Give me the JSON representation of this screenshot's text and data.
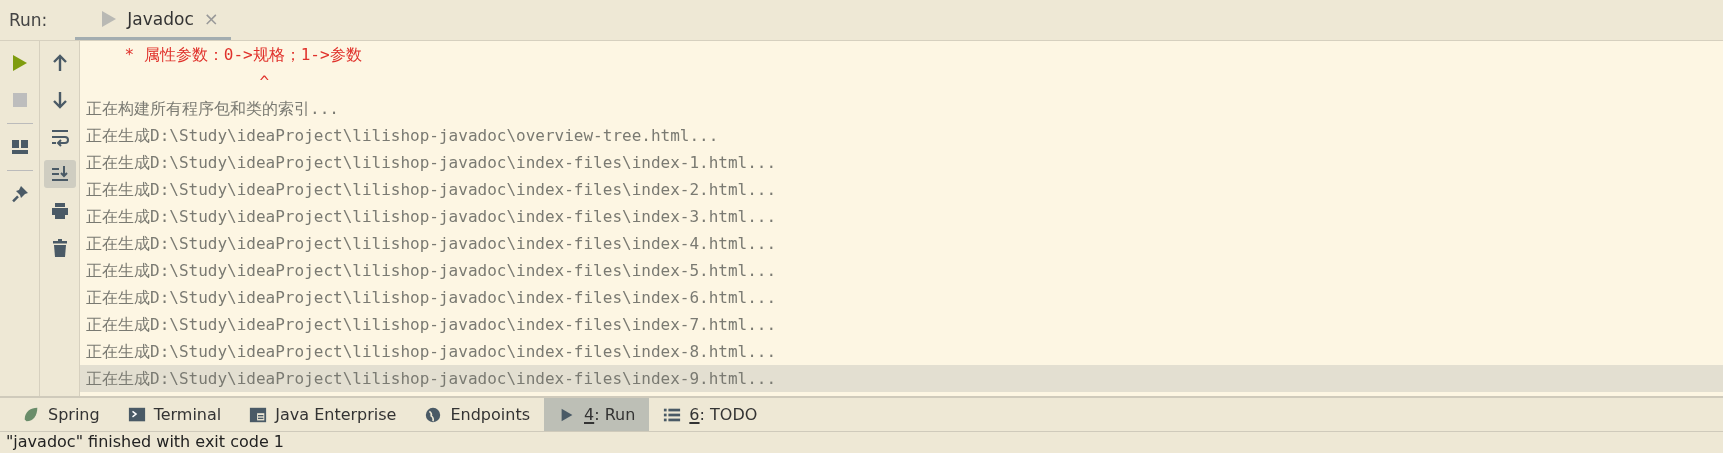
{
  "run_header": {
    "label": "Run:",
    "tabs": [
      {
        "label": "Javadoc",
        "selected": true,
        "close": "×"
      }
    ]
  },
  "left_toolbar": [
    {
      "kind": "run",
      "disabled": false
    },
    {
      "kind": "stop",
      "disabled": true
    },
    {
      "kind": "layout",
      "disabled": false
    },
    {
      "kind": "pin",
      "disabled": false
    }
  ],
  "console_toolbar": [
    {
      "kind": "up",
      "selected": false
    },
    {
      "kind": "down",
      "selected": false
    },
    {
      "kind": "wrap",
      "selected": false
    },
    {
      "kind": "scroll-end",
      "selected": true
    },
    {
      "kind": "print",
      "selected": false
    },
    {
      "kind": "delete",
      "selected": false
    }
  ],
  "console_lines": [
    {
      "kind": "error",
      "text": "    * 属性参数：0->规格；1->参数",
      "selected": false
    },
    {
      "kind": "error",
      "text": "                  ^",
      "selected": false
    },
    {
      "kind": "info",
      "text": "正在构建所有程序包和类的索引...",
      "selected": false
    },
    {
      "kind": "info",
      "text": "正在生成D:\\Study\\ideaProject\\lilishop-javadoc\\overview-tree.html...",
      "selected": false
    },
    {
      "kind": "info",
      "text": "正在生成D:\\Study\\ideaProject\\lilishop-javadoc\\index-files\\index-1.html...",
      "selected": false
    },
    {
      "kind": "info",
      "text": "正在生成D:\\Study\\ideaProject\\lilishop-javadoc\\index-files\\index-2.html...",
      "selected": false
    },
    {
      "kind": "info",
      "text": "正在生成D:\\Study\\ideaProject\\lilishop-javadoc\\index-files\\index-3.html...",
      "selected": false
    },
    {
      "kind": "info",
      "text": "正在生成D:\\Study\\ideaProject\\lilishop-javadoc\\index-files\\index-4.html...",
      "selected": false
    },
    {
      "kind": "info",
      "text": "正在生成D:\\Study\\ideaProject\\lilishop-javadoc\\index-files\\index-5.html...",
      "selected": false
    },
    {
      "kind": "info",
      "text": "正在生成D:\\Study\\ideaProject\\lilishop-javadoc\\index-files\\index-6.html...",
      "selected": false
    },
    {
      "kind": "info",
      "text": "正在生成D:\\Study\\ideaProject\\lilishop-javadoc\\index-files\\index-7.html...",
      "selected": false
    },
    {
      "kind": "info",
      "text": "正在生成D:\\Study\\ideaProject\\lilishop-javadoc\\index-files\\index-8.html...",
      "selected": false
    },
    {
      "kind": "info",
      "text": "正在生成D:\\Study\\ideaProject\\lilishop-javadoc\\index-files\\index-9.html...",
      "selected": true
    }
  ],
  "tool_tabs": [
    {
      "kind": "spring",
      "label": "Spring",
      "mnemonic": false,
      "selected": false
    },
    {
      "kind": "terminal",
      "label": "Terminal",
      "mnemonic": false,
      "selected": false
    },
    {
      "kind": "java-enterprise",
      "label": "Java Enterprise",
      "mnemonic": false,
      "selected": false
    },
    {
      "kind": "endpoints",
      "label": "Endpoints",
      "mnemonic": false,
      "selected": false
    },
    {
      "kind": "run",
      "label": "4: Run",
      "mnemonic": true,
      "selected": true
    },
    {
      "kind": "todo",
      "label": "6: TODO",
      "mnemonic": true,
      "selected": false
    }
  ],
  "status_bar": {
    "text": "\"javadoc\" finished with exit code 1"
  }
}
